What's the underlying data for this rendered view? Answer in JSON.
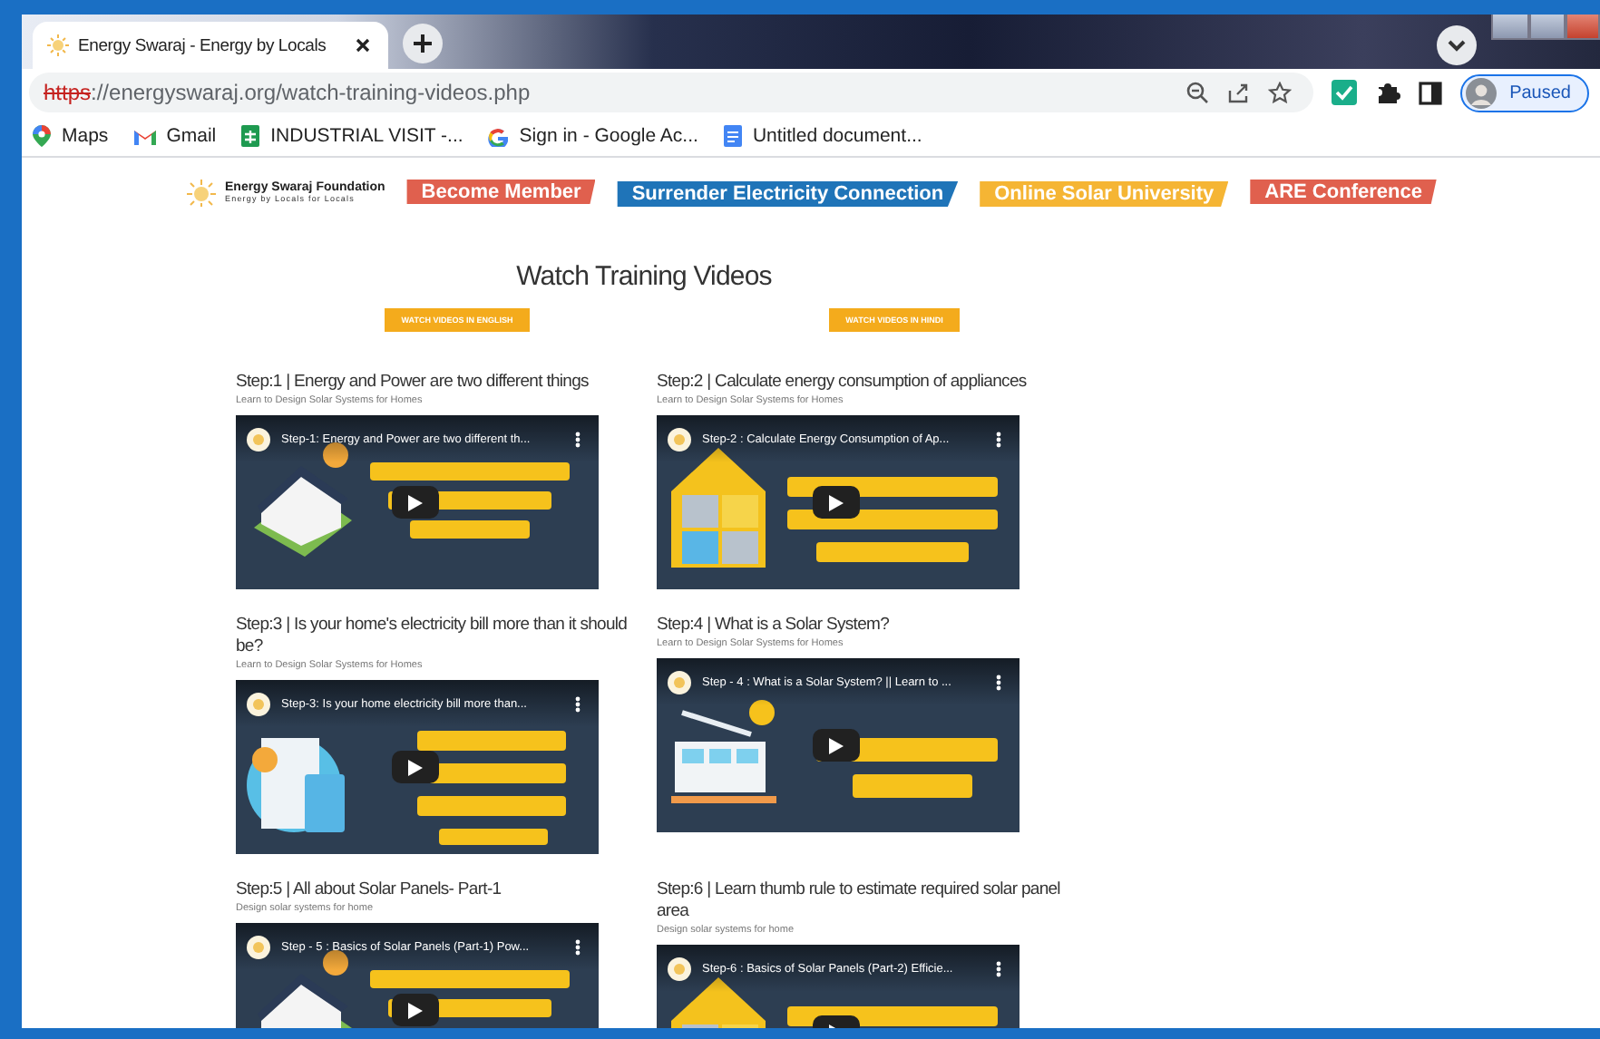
{
  "browser": {
    "tab": {
      "title": "Energy Swaraj - Energy by Locals",
      "selected": true
    },
    "url": {
      "scheme": "https",
      "rest": "://energyswaraj.org/watch-training-videos.php",
      "not_secure": true
    },
    "profile": {
      "label": "Paused"
    },
    "bookmarks": [
      {
        "label": "Maps",
        "kind": "maps"
      },
      {
        "label": "Gmail",
        "kind": "gmail"
      },
      {
        "label": "INDUSTRIAL VISIT -...",
        "kind": "sheet"
      },
      {
        "label": "Sign in - Google Ac...",
        "kind": "google"
      },
      {
        "label": "Untitled document...",
        "kind": "doc"
      }
    ]
  },
  "site": {
    "logo": {
      "name": "Energy Swaraj Foundation",
      "tagline": "Energy by Locals for Locals"
    },
    "nav": [
      {
        "label": "Become Member",
        "color": "#e0604e"
      },
      {
        "label": "Surrender Electricity Connection",
        "color": "#1f74b8"
      },
      {
        "label": "Online Solar University",
        "color": "#f5b534"
      },
      {
        "label": "ARE Conference",
        "color": "#e0604e"
      }
    ]
  },
  "heading": "Watch Training Videos",
  "language_buttons": [
    "WATCH VIDEOS IN ENGLISH",
    "WATCH VIDEOS IN HINDI"
  ],
  "videos": [
    {
      "title": "Step:1 | Energy and Power are two different things",
      "subtitle": "Learn to Design Solar Systems for Homes",
      "player_title": "Step-1: Energy and Power are two different th..."
    },
    {
      "title": "Step:2 | Calculate energy consumption of appliances",
      "subtitle": "Learn to Design Solar Systems for Homes",
      "player_title": "Step-2 : Calculate Energy Consumption of Ap..."
    },
    {
      "title": "Step:3 | Is your home's electricity bill more than it should be?",
      "subtitle": "Learn to Design Solar Systems for Homes",
      "player_title": "Step-3: Is your home electricity bill more than..."
    },
    {
      "title": "Step:4 | What is a Solar System?",
      "subtitle": "Learn to Design Solar Systems for Homes",
      "player_title": "Step - 4 : What is a Solar System? || Learn to ..."
    },
    {
      "title": "Step:5 | All about Solar Panels- Part-1",
      "subtitle": "Design solar systems for home",
      "player_title": "Step - 5 : Basics of Solar Panels (Part-1) Pow..."
    },
    {
      "title": "Step:6 | Learn thumb rule to estimate required solar panel area",
      "subtitle": "Design solar systems for home",
      "player_title": "Step-6 : Basics of Solar Panels (Part-2) Efficie..."
    }
  ]
}
